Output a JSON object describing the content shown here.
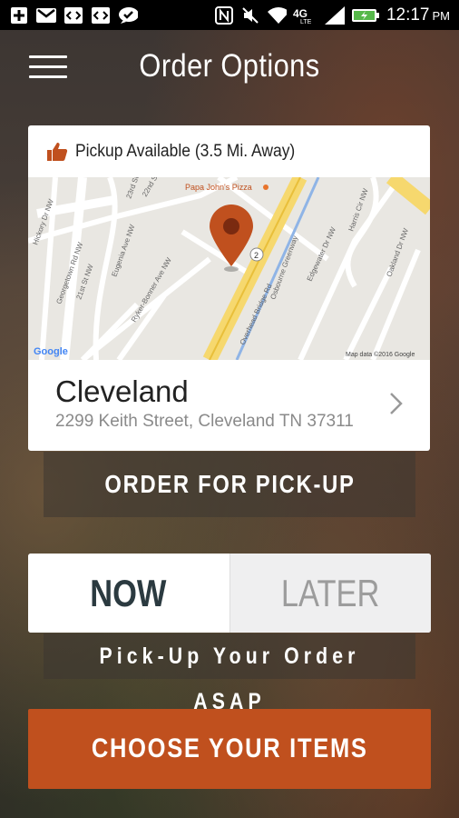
{
  "status_bar": {
    "time": "12:17",
    "ampm": "PM",
    "network": "4G LTE",
    "icons": [
      "plus-icon",
      "gmail-icon",
      "code-icon",
      "code-icon",
      "chat-bubble-icon",
      "nfc-icon",
      "mute-icon",
      "wifi-icon",
      "signal-icon",
      "battery-icon"
    ]
  },
  "header": {
    "title": "Order Options"
  },
  "location_card": {
    "availability": "Pickup Available (3.5 Mi. Away)",
    "map": {
      "poi": "Papa John's Pizza",
      "streets": [
        "23rd St",
        "22nd St",
        "Hickory Dr NW",
        "Georgetown Rd NW",
        "21st St NW",
        "Eugenia Ave NW",
        "Ryker-Bonner Ave NW",
        "Osbourne Greenway",
        "Overhead Bridge Rd",
        "Edgewater Dr NW",
        "Harris Cir NW",
        "Oakland Dr NW"
      ],
      "route_shield": "2",
      "attribution": "Map data ©2016 Google",
      "logo": "Google"
    },
    "store_name": "Cleveland",
    "address": "2299 Keith Street, Cleveland TN 37311"
  },
  "order_type_button": "ORDER FOR PICK-UP",
  "timing": {
    "now": "NOW",
    "later": "LATER",
    "selected": "now"
  },
  "timing_note": "Pick-Up Your Order ASAP",
  "choose_button": "CHOOSE YOUR ITEMS",
  "colors": {
    "accent": "#c0501e",
    "now_text": "#2b3a40",
    "pin": "#c0501e"
  }
}
